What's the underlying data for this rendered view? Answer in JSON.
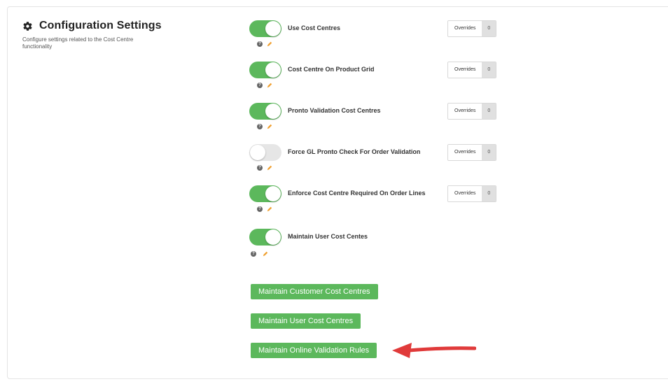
{
  "section": {
    "title": "Configuration Settings",
    "description": "Configure settings related to the Cost Centre functionality"
  },
  "settings": [
    {
      "label": "Use Cost Centres",
      "enabled": true,
      "overrides_label": "Overrides",
      "overrides_count": "0"
    },
    {
      "label": "Cost Centre On Product Grid",
      "enabled": true,
      "overrides_label": "Overrides",
      "overrides_count": "0"
    },
    {
      "label": "Pronto Validation Cost Centres",
      "enabled": true,
      "overrides_label": "Overrides",
      "overrides_count": "0"
    },
    {
      "label": "Force GL Pronto Check For Order Validation",
      "enabled": false,
      "overrides_label": "Overrides",
      "overrides_count": "0"
    },
    {
      "label": "Enforce Cost Centre Required On Order Lines",
      "enabled": true,
      "overrides_label": "Overrides",
      "overrides_count": "0"
    },
    {
      "label": "Maintain User Cost Centes",
      "enabled": true
    }
  ],
  "buttons": {
    "maintain_customer": "Maintain Customer Cost Centres",
    "maintain_user": "Maintain User Cost Centres",
    "maintain_validation": "Maintain Online Validation Rules"
  },
  "icons": {
    "section": "gear-icon",
    "help": "question-icon",
    "edit": "pencil-icon",
    "annotation": "red-arrow"
  },
  "colors": {
    "toggle_on": "#5cb85c",
    "toggle_off": "#e6e6e6",
    "button": "#5cb85c",
    "edit_icon": "#f0a030",
    "annotation_arrow": "#e03a3a"
  }
}
